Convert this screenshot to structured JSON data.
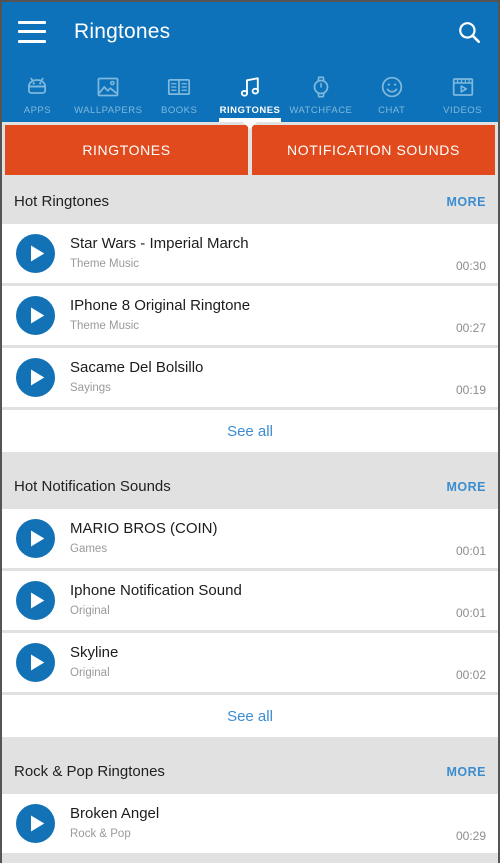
{
  "appbar": {
    "title": "Ringtones",
    "menu_icon": "hamburger-menu-icon",
    "search_icon": "search-icon"
  },
  "category_tabs": [
    {
      "label": "APPS",
      "icon": "android-robot-icon",
      "active": false
    },
    {
      "label": "WALLPAPERS",
      "icon": "image-photo-icon",
      "active": false
    },
    {
      "label": "BOOKS",
      "icon": "open-book-icon",
      "active": false
    },
    {
      "label": "RINGTONES",
      "icon": "music-note-icon",
      "active": true
    },
    {
      "label": "WATCHFACE",
      "icon": "watch-icon",
      "active": false
    },
    {
      "label": "CHAT",
      "icon": "smiley-face-icon",
      "active": false
    },
    {
      "label": "VIDEOS",
      "icon": "video-play-icon",
      "active": false
    }
  ],
  "segments": [
    {
      "label": "RINGTONES"
    },
    {
      "label": "NOTIFICATION SOUNDS"
    }
  ],
  "more_label": "MORE",
  "see_all_label": "See all",
  "sections": [
    {
      "title": "Hot Ringtones",
      "more": "MORE",
      "see_all": "See all",
      "items": [
        {
          "title": "Star Wars - Imperial March",
          "category": "Theme Music",
          "duration": "00:30"
        },
        {
          "title": "IPhone 8 Original Ringtone",
          "category": "Theme Music",
          "duration": "00:27"
        },
        {
          "title": "Sacame Del Bolsillo",
          "category": "Sayings",
          "duration": "00:19"
        }
      ]
    },
    {
      "title": "Hot Notification Sounds",
      "more": "MORE",
      "see_all": "See all",
      "items": [
        {
          "title": "MARIO BROS (COIN)",
          "category": "Games",
          "duration": "00:01"
        },
        {
          "title": "Iphone Notification Sound",
          "category": "Original",
          "duration": "00:01"
        },
        {
          "title": "Skyline",
          "category": "Original",
          "duration": "00:02"
        }
      ]
    },
    {
      "title": "Rock & Pop Ringtones",
      "more": "MORE",
      "see_all": "",
      "items": [
        {
          "title": "Broken Angel",
          "category": "Rock & Pop",
          "duration": "00:29"
        }
      ]
    }
  ],
  "colors": {
    "primary_blue": "#0d72b9",
    "accent_orange": "#e04a1d",
    "link_blue": "#3b8dd0",
    "page_bg": "#e1e1e1",
    "card_bg": "#ffffff",
    "play_blue": "#1272b5"
  }
}
